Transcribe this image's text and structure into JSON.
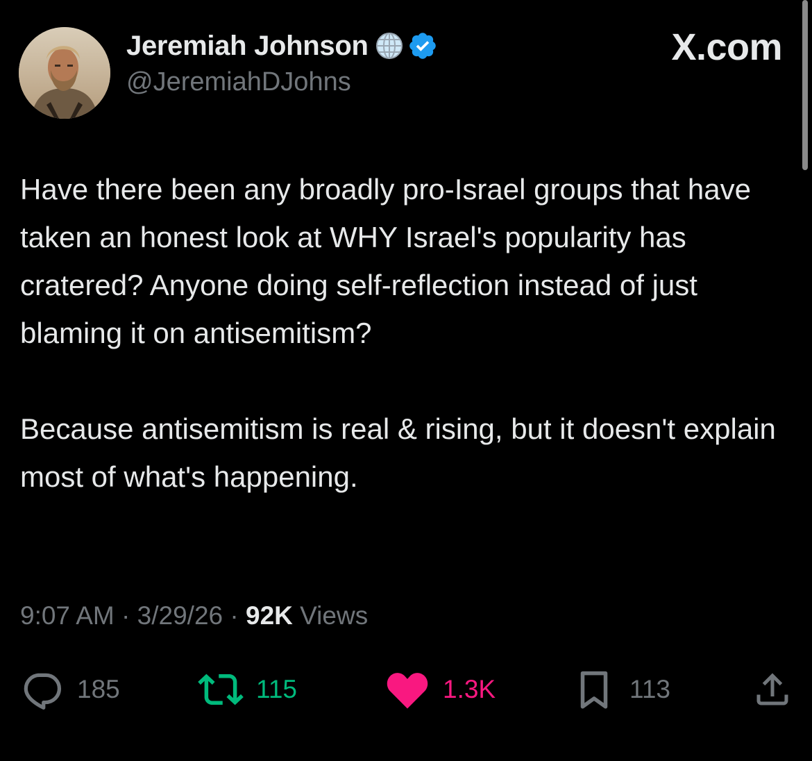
{
  "brand": {
    "label": "X.com"
  },
  "author": {
    "display_name": "Jeremiah Johnson",
    "handle": "@JeremiahDJohns",
    "badges": [
      "globe-icon",
      "verified-icon"
    ]
  },
  "tweet": {
    "paragraphs": [
      "Have there been any broadly pro-Israel groups that have taken an honest look at WHY Israel's popularity has cratered? Anyone doing self-reflection instead of just blaming it on antisemitism?",
      "Because antisemitism is real & rising, but it doesn't explain most of what's happening."
    ]
  },
  "meta": {
    "time": "9:07 AM",
    "separator": " · ",
    "date": "3/29/26",
    "views_count": "92K",
    "views_label": " Views"
  },
  "actions": {
    "replies": "185",
    "reposts": "115",
    "likes": "1.3K",
    "bookmarks": "113"
  },
  "colors": {
    "background": "#000000",
    "text": "#e7e9ea",
    "secondary": "#71767b",
    "verified": "#1d9bf0",
    "repost_active": "#00ba7c",
    "like_active": "#f91880"
  }
}
